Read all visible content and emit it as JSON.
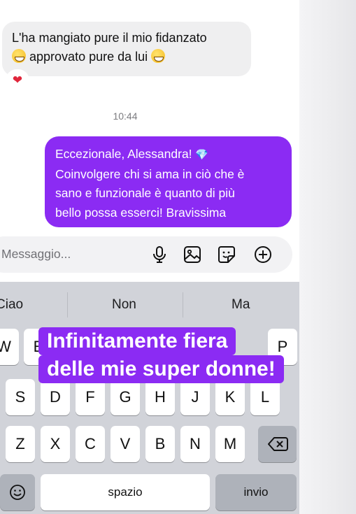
{
  "chat": {
    "incoming_message": {
      "line1": "L'ha mangiato pure il mio fidanzato",
      "line2": "approvato pure da lui",
      "emoji": "grinning-face",
      "reaction": "❤"
    },
    "timestamp": "10:44",
    "outgoing_message": {
      "line1": "Eccezionale, Alessandra!",
      "line1_emoji": "💎",
      "line2": "Coinvolgere chi si ama in ciò che è",
      "line3": "sano e funzionale è quanto di più",
      "line4": "bello possa esserci! Bravissima"
    }
  },
  "composer": {
    "placeholder": "Messaggio...",
    "icons": [
      "microphone-icon",
      "image-icon",
      "sticker-icon",
      "plus-icon"
    ]
  },
  "keyboard": {
    "suggestions": [
      "Ciao",
      "Non",
      "Ma"
    ],
    "row1": [
      "W",
      "E",
      "P"
    ],
    "row2": [
      "S",
      "D",
      "F",
      "G",
      "H",
      "J",
      "K",
      "L"
    ],
    "row3": [
      "Z",
      "X",
      "C",
      "V",
      "B",
      "N",
      "M"
    ],
    "space_label": "spazio",
    "return_label": "invio",
    "emoji_key": "emoji-icon",
    "delete_key": "backspace-icon"
  },
  "overlay_caption": {
    "line1": "Infinitamente fiera",
    "line2": "delle mie super donne!"
  },
  "colors": {
    "accent_purple": "#8b2bf3",
    "incoming_bubble": "#efeff0",
    "keyboard_bg": "#d1d3d9"
  }
}
